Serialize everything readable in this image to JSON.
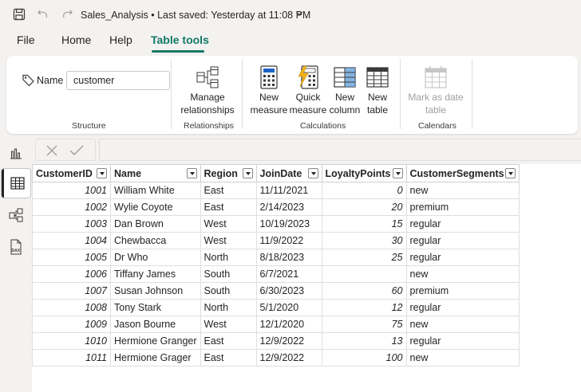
{
  "titlebar": {
    "title": "Sales_Analysis • Last saved: Yesterday at 11:08 PM",
    "icons": [
      "save-icon",
      "undo-icon",
      "redo-icon",
      "chevron-down-icon"
    ]
  },
  "menu": {
    "items": [
      "File",
      "Home",
      "Help",
      "Table tools"
    ],
    "active": "Table tools",
    "accent_color": "#117865"
  },
  "ribbon": {
    "structure": {
      "name_label": "Name",
      "name_value": "customer",
      "group_label": "Structure"
    },
    "relationships": {
      "manage_label_1": "Manage",
      "manage_label_2": "relationships",
      "group_label": "Relationships"
    },
    "calculations": {
      "new_measure_1": "New",
      "new_measure_2": "measure",
      "quick_measure_1": "Quick",
      "quick_measure_2": "measure",
      "new_column_1": "New",
      "new_column_2": "column",
      "new_table_1": "New",
      "new_table_2": "table",
      "group_label": "Calculations"
    },
    "calendars": {
      "mark_date_1": "Mark as date",
      "mark_date_2": "table",
      "group_label": "Calendars"
    }
  },
  "table": {
    "columns": [
      "CustomerID",
      "Name",
      "Region",
      "JoinDate",
      "LoyaltyPoints",
      "CustomerSegments"
    ],
    "rows": [
      [
        "1001",
        "William White",
        "East",
        "11/11/2021",
        "0",
        "new"
      ],
      [
        "1002",
        "Wylie Coyote",
        "East",
        "2/14/2023",
        "20",
        "premium"
      ],
      [
        "1003",
        "Dan Brown",
        "West",
        "10/19/2023",
        "15",
        "regular"
      ],
      [
        "1004",
        "Chewbacca",
        "West",
        "11/9/2022",
        "30",
        "regular"
      ],
      [
        "1005",
        "Dr Who",
        "North",
        "8/18/2023",
        "25",
        "regular"
      ],
      [
        "1006",
        "Tiffany James",
        "South",
        "6/7/2021",
        "",
        "new"
      ],
      [
        "1007",
        "Susan Johnson",
        "South",
        "6/30/2023",
        "60",
        "premium"
      ],
      [
        "1008",
        "Tony Stark",
        "North",
        "5/1/2020",
        "12",
        "regular"
      ],
      [
        "1009",
        "Jason Bourne",
        "West",
        "12/1/2020",
        "75",
        "new"
      ],
      [
        "1010",
        "Hermione Granger",
        "East",
        "12/9/2022",
        "13",
        "regular"
      ],
      [
        "1011",
        "Hermione Grager",
        "East",
        "12/9/2022",
        "100",
        "new"
      ]
    ]
  }
}
